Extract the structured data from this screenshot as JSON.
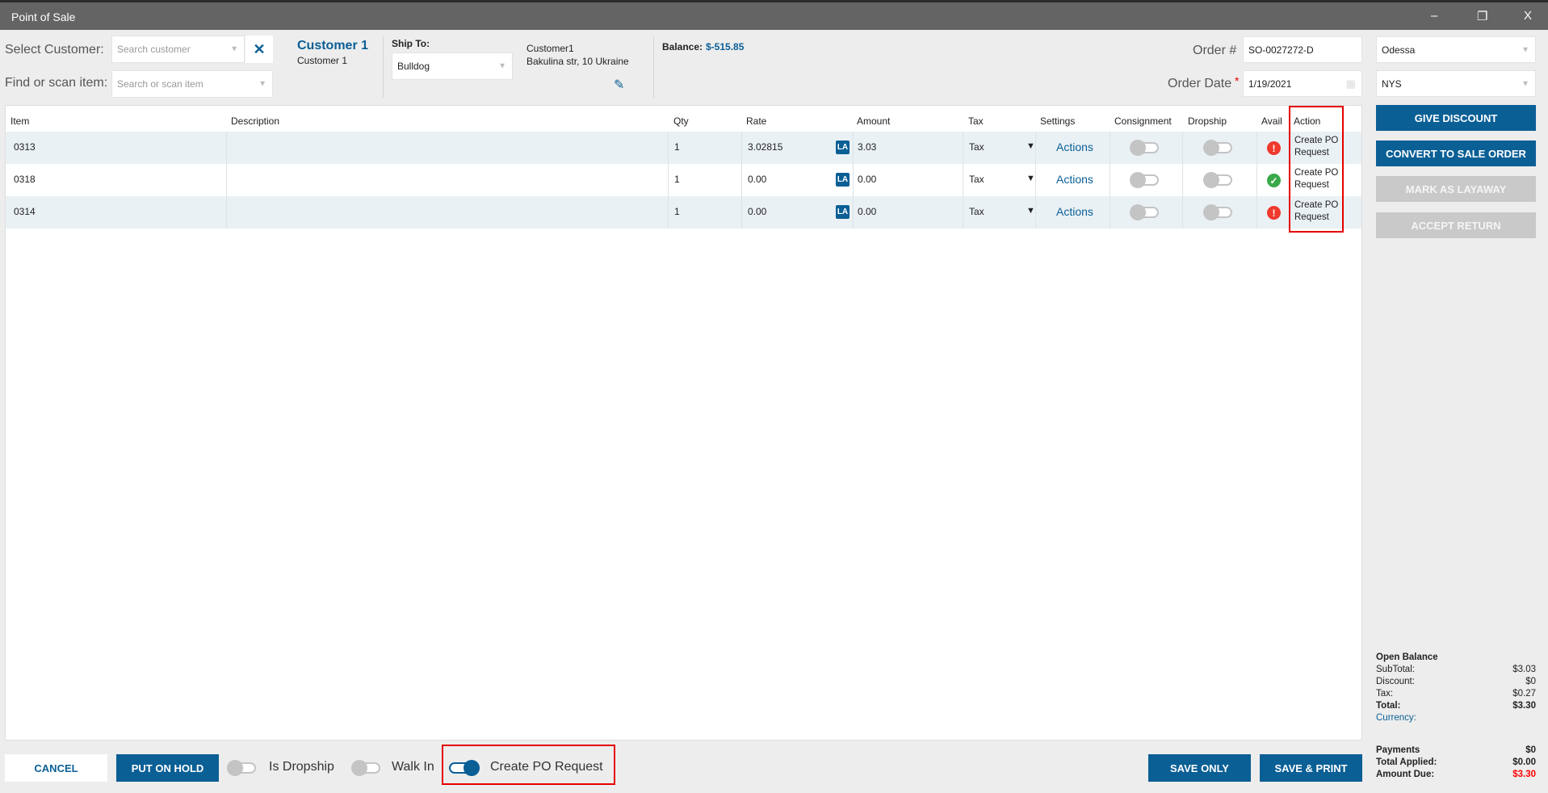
{
  "window": {
    "title": "Point of Sale",
    "minimize": "–",
    "restore": "❐",
    "close": "X"
  },
  "header": {
    "select_customer_label": "Select Customer:",
    "search_customer_placeholder": "Search customer",
    "clear_icon": "✕",
    "find_item_label": "Find or scan item:",
    "find_item_placeholder": "Search or scan item",
    "customer_name": "Customer 1",
    "customer_sub": "Customer 1",
    "ship_to_label": "Ship To:",
    "ship_to_value": "Bulldog",
    "address_line1": "Customer1",
    "address_line2": "Bakulina str, 10 Ukraine",
    "balance_label": "Balance:",
    "balance_value": "$-515.85",
    "order_no_label": "Order #",
    "order_no_value": "SO-0027272-D",
    "order_date_label": "Order Date",
    "order_date_required": "*",
    "order_date_value": "1/19/2021",
    "location_value": "Odessa",
    "tax_region_value": "NYS"
  },
  "table": {
    "columns": [
      "Item",
      "Description",
      "Qty",
      "Rate",
      "Amount",
      "Tax",
      "Settings",
      "Consignment",
      "Dropship",
      "Avail",
      "Action"
    ],
    "rows": [
      {
        "item": "0313",
        "description": "",
        "qty": "1",
        "rate": "3.02815",
        "badge": "LA",
        "amount": "3.03",
        "tax": "Tax",
        "settings": "Actions",
        "consignment": false,
        "dropship": false,
        "avail": "warning",
        "action_line1": "Create PO",
        "action_line2": "Request"
      },
      {
        "item": "0318",
        "description": "",
        "qty": "1",
        "rate": "0.00",
        "badge": "LA",
        "amount": "0.00",
        "tax": "Tax",
        "settings": "Actions",
        "consignment": false,
        "dropship": false,
        "avail": "ok",
        "action_line1": "Create PO",
        "action_line2": "Request"
      },
      {
        "item": "0314",
        "description": "",
        "qty": "1",
        "rate": "0.00",
        "badge": "LA",
        "amount": "0.00",
        "tax": "Tax",
        "settings": "Actions",
        "consignment": false,
        "dropship": false,
        "avail": "warning",
        "action_line1": "Create PO",
        "action_line2": "Request"
      }
    ]
  },
  "side_buttons": {
    "give_discount": "GIVE DISCOUNT",
    "convert": "CONVERT TO SALE ORDER",
    "layaway": "MARK AS LAYAWAY",
    "accept_return": "ACCEPT RETURN"
  },
  "summary": {
    "open_balance": "Open Balance",
    "subtotal_label": "SubTotal:",
    "subtotal": "$3.03",
    "discount_label": "Discount:",
    "discount": "$0",
    "tax_label": "Tax:",
    "tax": "$0.27",
    "total_label": "Total:",
    "total": "$3.30",
    "currency_label": "Currency:",
    "payments_label": "Payments",
    "payments": "$0",
    "applied_label": "Total Applied:",
    "applied": "$0.00",
    "due_label": "Amount Due:",
    "due": "$3.30"
  },
  "footer": {
    "cancel": "CANCEL",
    "hold": "PUT ON HOLD",
    "is_dropship": "Is Dropship",
    "is_dropship_on": false,
    "walk_in": "Walk In",
    "walk_in_on": false,
    "create_po": "Create PO Request",
    "create_po_on": true,
    "save_only": "SAVE ONLY",
    "save_print": "SAVE & PRINT"
  },
  "colors": {
    "accent": "#0a5f95",
    "titlebar": "#646464",
    "highlight": "#e50000",
    "due": "#ff0000"
  }
}
